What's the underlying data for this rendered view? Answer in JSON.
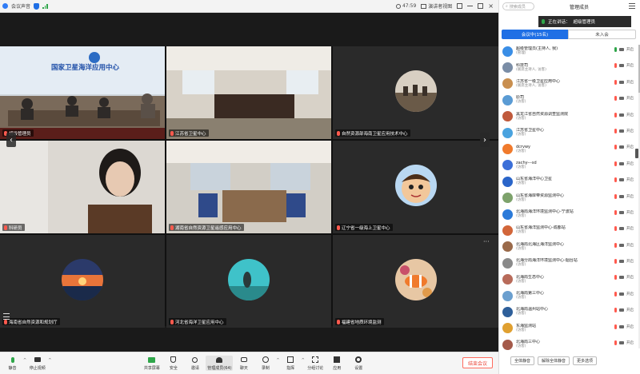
{
  "topbar": {
    "app_title": "会议声音",
    "time": "47:59",
    "view_label": "演讲者视图"
  },
  "tiles": [
    {
      "label": "超级管理员",
      "mic": "red"
    },
    {
      "label": "江苏省卫星中心",
      "mic": "red"
    },
    {
      "label": "自然资源部海南卫星应用技术中心",
      "mic": "red"
    },
    {
      "label": "科研员",
      "mic": "red"
    },
    {
      "label": "湖南省自然资源卫星遥感应用中心",
      "mic": "red"
    },
    {
      "label": "辽宁省一级海上卫星中心",
      "mic": "red"
    },
    {
      "label": "海南省自然资源和规划厅",
      "mic": "red"
    },
    {
      "label": "河北省海洋卫星应用中心",
      "mic": "red"
    },
    {
      "label": "福建省地质环境监测",
      "mic": "red"
    }
  ],
  "room_sign": "国家卫星海洋应用中心",
  "toolbar": {
    "buttons": [
      {
        "label": "静音",
        "icon": "microphone-icon"
      },
      {
        "label": "停止视频",
        "icon": "camera-icon"
      },
      {
        "label": "共享屏幕",
        "icon": "share-screen-icon"
      },
      {
        "label": "安全",
        "icon": "shield-icon"
      },
      {
        "label": "邀请",
        "icon": "invite-icon"
      },
      {
        "label": "管理成员(64)",
        "icon": "members-icon"
      },
      {
        "label": "聊天",
        "icon": "chat-icon"
      },
      {
        "label": "录制",
        "icon": "record-icon"
      },
      {
        "label": "指挥",
        "icon": "command-icon"
      },
      {
        "label": "分组讨论",
        "icon": "breakout-icon"
      },
      {
        "label": "应用",
        "icon": "apps-icon"
      },
      {
        "label": "设置",
        "icon": "settings-icon"
      }
    ],
    "end_label": "结束会议"
  },
  "panel": {
    "search_placeholder": "搜索成员",
    "title": "管理成员",
    "speaking_prefix": "正在讲话：",
    "speaking_name": "超级管理员",
    "tab_in": "会议中(15名)",
    "tab_out": "未入会",
    "participants": [
      {
        "name": "超级管理员(主持人, 我)",
        "role": "(管理)",
        "avatar": "#3a8ee6",
        "mic": "on",
        "cam": "开启"
      },
      {
        "name": "科技司",
        "role": "(联席主持人, 访客)",
        "avatar": "#7a8da6",
        "mic": "off",
        "cam": "开启"
      },
      {
        "name": "江苏省一级卫星应用中心",
        "role": "(联席主持人, 访客)",
        "avatar": "#c98f4f",
        "mic": "off",
        "cam": "开启"
      },
      {
        "name": "原司",
        "role": "(访客)",
        "avatar": "#5a9bd4",
        "mic": "off",
        "cam": "开启"
      },
      {
        "name": "黑龙江省自然资源调查监测院",
        "role": "(访客)",
        "avatar": "#c05a3c",
        "mic": "off",
        "cam": "开启"
      },
      {
        "name": "江苏省卫星中心",
        "role": "(访客)",
        "avatar": "#4aa3df",
        "mic": "off",
        "cam": "开启"
      },
      {
        "name": "dcrvwy",
        "role": "(访客)",
        "avatar": "#f07a2c",
        "mic": "off",
        "cam": "开启"
      },
      {
        "name": "zachy---sd",
        "role": "(访客)",
        "avatar": "#3b6fd8",
        "mic": "off",
        "cam": "开启"
      },
      {
        "name": "山东省海洋中心卫星",
        "role": "(访客)",
        "avatar": "#2a65c9",
        "mic": "off",
        "cam": "开启"
      },
      {
        "name": "山东省海岸带资源监测中心",
        "role": "(访客)",
        "avatar": "#7da26b",
        "mic": "off",
        "cam": "开启"
      },
      {
        "name": "北海局海洋环境监测中心-宁波站",
        "role": "(访客)",
        "avatar": "#2b7ad9",
        "mic": "off",
        "cam": "开启"
      },
      {
        "name": "山东省海洋监测中心-成都站",
        "role": "(访客)",
        "avatar": "#d2663a",
        "mic": "off",
        "cam": "开启"
      },
      {
        "name": "北海局北海区海洋监测中心",
        "role": "(访客)",
        "avatar": "#9a6a4a",
        "mic": "off",
        "cam": "开启"
      },
      {
        "name": "北海分局海洋环境监测中心-烟台站",
        "role": "(访客)",
        "avatar": "#8a8a8a",
        "mic": "off",
        "cam": "开启"
      },
      {
        "name": "北海局生态中心",
        "role": "(访客)",
        "avatar": "#b86b5a",
        "mic": "off",
        "cam": "开启"
      },
      {
        "name": "北海局第三中心",
        "role": "(访客)",
        "avatar": "#6b9fcf",
        "mic": "off",
        "cam": "开启"
      },
      {
        "name": "北海局温州站中心",
        "role": "(访客)",
        "avatar": "#2e5f9a",
        "mic": "off",
        "cam": "开启"
      },
      {
        "name": "东海监测站",
        "role": "(访客)",
        "avatar": "#e0a030",
        "mic": "off",
        "cam": "开启"
      },
      {
        "name": "北海局三中心",
        "role": "(访客)",
        "avatar": "#a45a4a",
        "mic": "off",
        "cam": "开启"
      },
      {
        "name": "大连海洋中心",
        "role": "(访客)",
        "avatar": "#c87a3a",
        "mic": "off",
        "cam": "开启"
      }
    ],
    "footer": {
      "mute_all": "全体静音",
      "unmute_all": "解除全体静音",
      "more": "更多选项"
    }
  }
}
